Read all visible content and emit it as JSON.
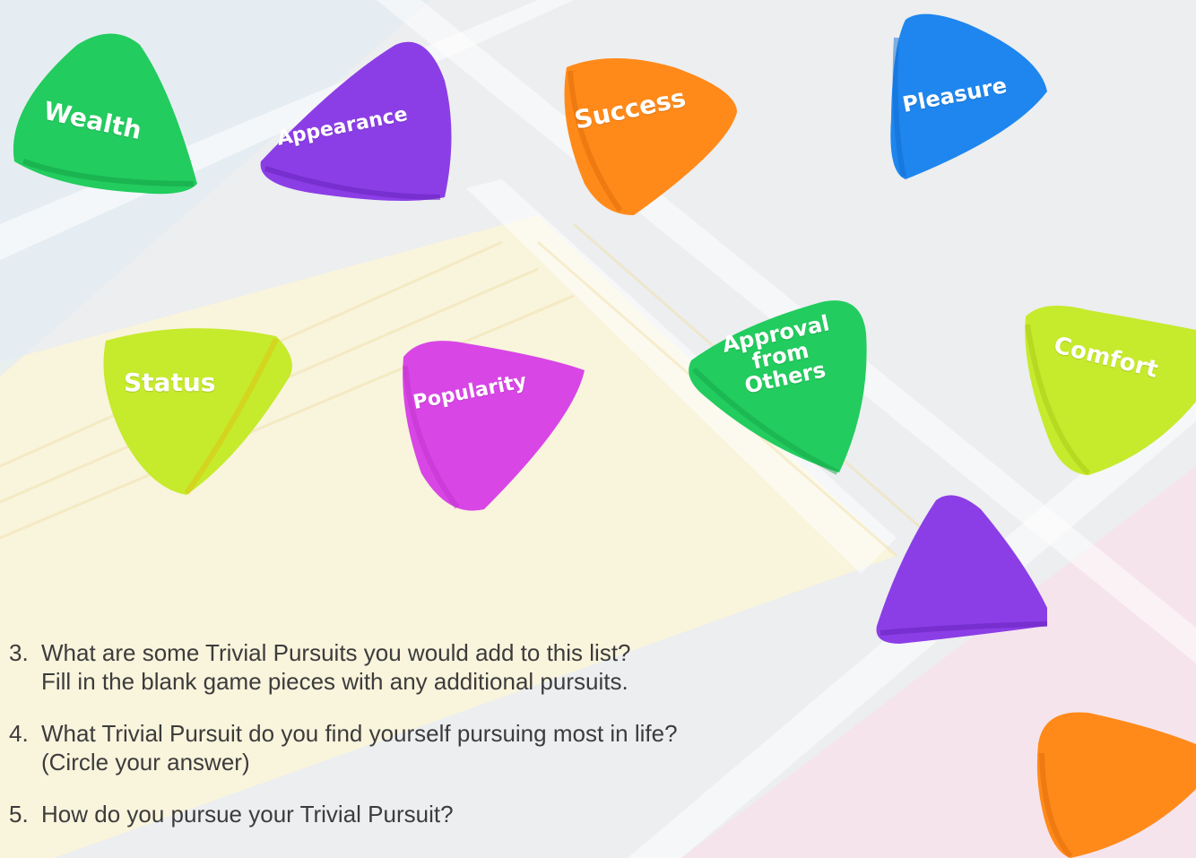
{
  "colors": {
    "green": "#22cc5e",
    "purple": "#8b3ee6",
    "orange": "#ff8a1a",
    "blue": "#1e86ee",
    "lime": "#c6ea2c",
    "magenta": "#d846e6",
    "cream": "#fbf6dc",
    "pink": "#f6e0ea"
  },
  "pieces": [
    {
      "label": "Wealth",
      "color": "green",
      "icon": "triangle-game-piece"
    },
    {
      "label": "Appearance",
      "color": "purple",
      "icon": "triangle-game-piece"
    },
    {
      "label": "Success",
      "color": "orange",
      "icon": "triangle-game-piece"
    },
    {
      "label": "Pleasure",
      "color": "blue",
      "icon": "triangle-game-piece"
    },
    {
      "label": "Status",
      "color": "lime",
      "icon": "triangle-game-piece"
    },
    {
      "label": "Popularity",
      "color": "magenta",
      "icon": "triangle-game-piece"
    },
    {
      "label": "Approval from Others",
      "lines": [
        "Approval",
        "from",
        "Others"
      ],
      "color": "green",
      "icon": "triangle-game-piece"
    },
    {
      "label": "Comfort",
      "color": "lime",
      "icon": "triangle-game-piece"
    },
    {
      "label": "",
      "color": "purple",
      "icon": "triangle-game-piece"
    },
    {
      "label": "",
      "color": "orange",
      "icon": "triangle-game-piece"
    }
  ],
  "questions": [
    {
      "number": "3.",
      "lines": [
        "What are some Trivial Pursuits you would add to this list?",
        "Fill in the blank game pieces with any additional pursuits."
      ]
    },
    {
      "number": "4.",
      "lines": [
        "What Trivial Pursuit do you find yourself pursuing most in life?",
        "(Circle your answer)"
      ]
    },
    {
      "number": "5.",
      "lines": [
        "How do you pursue your Trivial Pursuit?"
      ]
    }
  ]
}
